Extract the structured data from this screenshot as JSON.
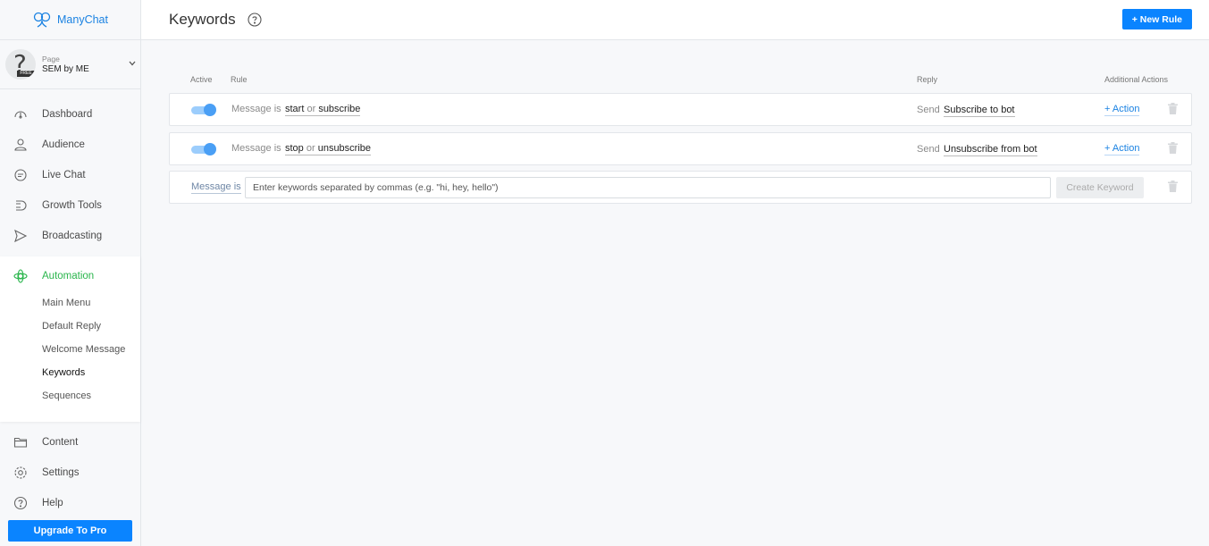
{
  "brand": {
    "name": "ManyChat"
  },
  "page_selector": {
    "label": "Page",
    "name": "SEM by ME",
    "badge": "FREE"
  },
  "nav": {
    "dashboard": "Dashboard",
    "audience": "Audience",
    "live_chat": "Live Chat",
    "growth_tools": "Growth Tools",
    "broadcasting": "Broadcasting",
    "automation": "Automation",
    "automation_items": {
      "main_menu": "Main Menu",
      "default_reply": "Default Reply",
      "welcome_message": "Welcome Message",
      "keywords": "Keywords",
      "sequences": "Sequences"
    },
    "content": "Content",
    "settings": "Settings",
    "help": "Help",
    "upgrade": "Upgrade To Pro"
  },
  "header": {
    "title": "Keywords",
    "new_rule": "+ New Rule"
  },
  "table": {
    "columns": {
      "active": "Active",
      "rule": "Rule",
      "reply": "Reply",
      "actions": "Additional Actions"
    },
    "rows": [
      {
        "active": true,
        "condition": "Message is",
        "kw1": "start",
        "or": "or",
        "kw2": "subscribe",
        "send": "Send",
        "reply": "Subscribe to bot",
        "action": "+ Action"
      },
      {
        "active": true,
        "condition": "Message is",
        "kw1": "stop",
        "or": "or",
        "kw2": "unsubscribe",
        "send": "Send",
        "reply": "Unsubscribe from bot",
        "action": "+ Action"
      }
    ],
    "new_rule": {
      "condition": "Message is",
      "input_placeholder": "Enter keywords separated by commas (e.g. \"hi, hey, hello\")",
      "create_label": "Create Keyword"
    }
  },
  "colors": {
    "accent": "#0a84ff",
    "automation": "#2ab54c",
    "link": "#1a82e2"
  }
}
